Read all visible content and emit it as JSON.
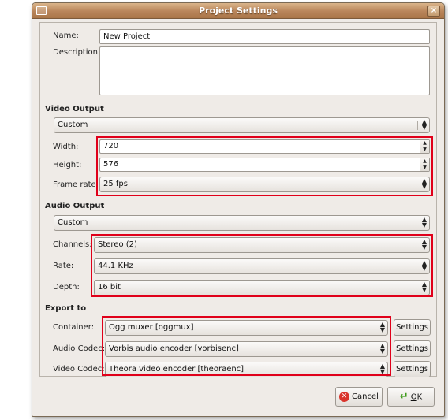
{
  "window": {
    "title": "Project Settings"
  },
  "project": {
    "name_label": "Name:",
    "name_value": "New Project",
    "description_label": "Description:",
    "description_value": ""
  },
  "video": {
    "header": "Video Output",
    "preset": "Custom",
    "width_label": "Width:",
    "width_value": "720",
    "height_label": "Height:",
    "height_value": "576",
    "framerate_label": "Frame rate:",
    "framerate_value": "25 fps"
  },
  "audio": {
    "header": "Audio Output",
    "preset": "Custom",
    "channels_label": "Channels:",
    "channels_value": "Stereo (2)",
    "rate_label": "Rate:",
    "rate_value": "44.1 KHz",
    "depth_label": "Depth:",
    "depth_value": "16 bit"
  },
  "export": {
    "header": "Export to",
    "container_label": "Container:",
    "container_value": "Ogg muxer [oggmux]",
    "audio_codec_label": "Audio Codec:",
    "audio_codec_value": "Vorbis audio encoder [vorbisenc]",
    "video_codec_label": "Video Codec:",
    "video_codec_value": "Theora video encoder [theoraenc]",
    "settings_label": "Settings"
  },
  "buttons": {
    "cancel_prefix": "",
    "cancel_mnemonic": "C",
    "cancel_rest": "ancel",
    "ok_mnemonic": "O",
    "ok_rest": "K"
  },
  "colors": {
    "highlight": "#e0001a",
    "titlebar": "#b9855a",
    "window_bg": "#efebe7"
  },
  "icons": [
    "window-menu-icon",
    "close-icon",
    "dropdown-arrows-icon",
    "spin-arrows-icon",
    "cancel-icon",
    "ok-check-icon"
  ]
}
